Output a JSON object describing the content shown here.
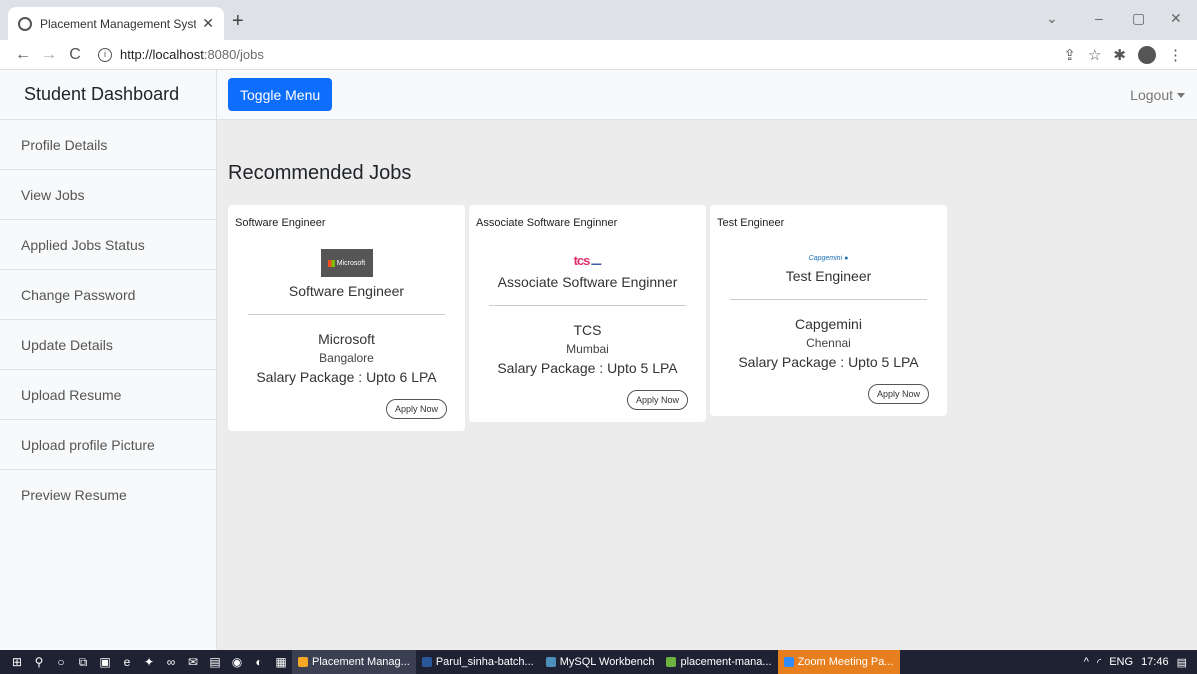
{
  "browser": {
    "tab_title": "Placement Management System",
    "tab_close": "✕",
    "new_tab": "+",
    "url_host": "http://localhost",
    "url_path": ":8080/jobs",
    "win_min": "–",
    "win_max": "▢",
    "win_close": "✕",
    "win_down": "⌄"
  },
  "sidebar": {
    "heading": "Student Dashboard",
    "items": [
      {
        "label": "Profile Details"
      },
      {
        "label": "View Jobs"
      },
      {
        "label": "Applied Jobs Status"
      },
      {
        "label": "Change Password"
      },
      {
        "label": "Update Details"
      },
      {
        "label": "Upload Resume"
      },
      {
        "label": "Upload profile Picture"
      },
      {
        "label": "Preview Resume"
      }
    ]
  },
  "topnav": {
    "toggle_label": "Toggle Menu",
    "logout_label": "Logout"
  },
  "main": {
    "title": "Recommended Jobs",
    "jobs": [
      {
        "role": "Software Engineer",
        "logo_text": "Microsoft",
        "company": "Microsoft",
        "city": "Bangalore",
        "salary": "Salary Package : Upto  6  LPA",
        "apply": "Apply Now"
      },
      {
        "role": "Associate Software Enginner",
        "logo_text": "tcs",
        "company": "TCS",
        "city": "Mumbai",
        "salary": "Salary Package : Upto  5  LPA",
        "apply": "Apply Now"
      },
      {
        "role": "Test Engineer",
        "logo_text": "Capgemini",
        "company": "Capgemini",
        "city": "Chennai",
        "salary": "Salary Package : Upto  5  LPA",
        "apply": "Apply Now"
      }
    ]
  },
  "taskbar": {
    "apps": [
      {
        "label": "Placement Manag...",
        "color": "#f5a623"
      },
      {
        "label": "Parul_sinha-batch...",
        "color": "#2b579a"
      },
      {
        "label": "MySQL Workbench",
        "color": "#4c8fbd"
      },
      {
        "label": "placement-mana...",
        "color": "#6db33f"
      },
      {
        "label": "Zoom Meeting Pa...",
        "color": "#2d8cff"
      }
    ],
    "lang": "ENG",
    "time": "17:46"
  },
  "colors": {
    "primary_button": "#0d6efd",
    "content_bg": "#ececec",
    "taskbar_bg": "#1f2233"
  }
}
